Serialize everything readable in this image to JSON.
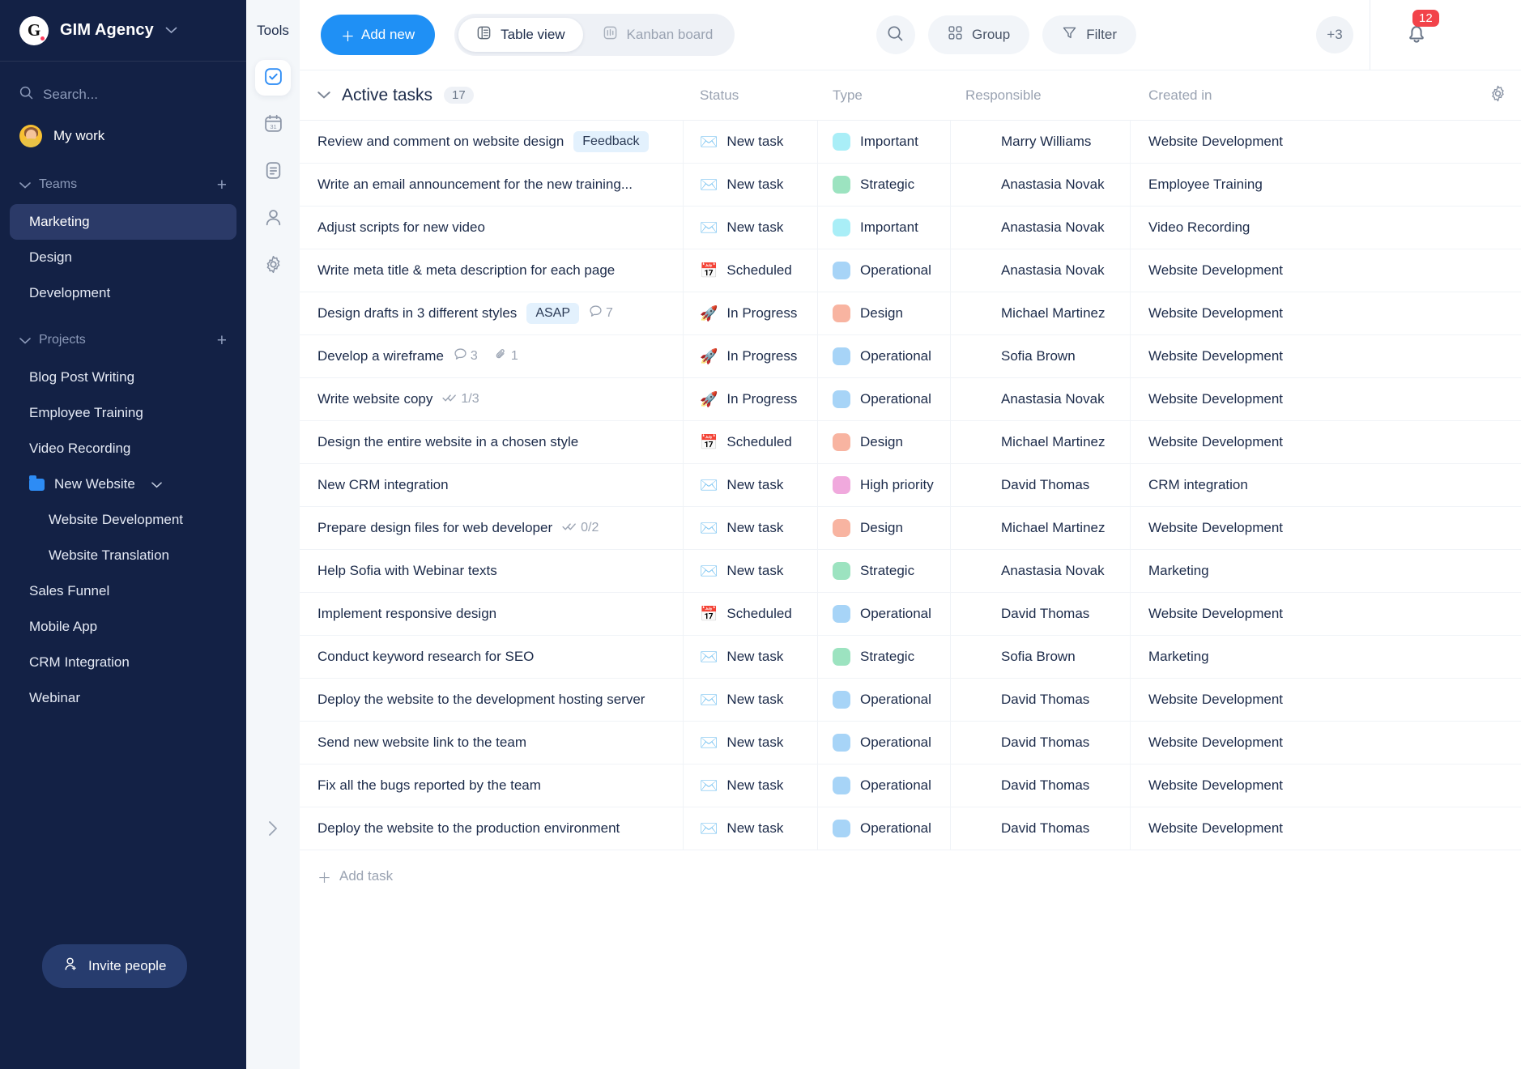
{
  "sidebar": {
    "brand": {
      "logo_letter": "G",
      "name": "GIM Agency",
      "caret": "chevron-down"
    },
    "search_placeholder": "Search...",
    "my_work": "My work",
    "teams_group": {
      "label": "Teams",
      "add": "+"
    },
    "teams": [
      "Marketing",
      "Design",
      "Development"
    ],
    "active_team": "Marketing",
    "projects_group": {
      "label": "Projects",
      "add": "+"
    },
    "projects": [
      "Blog Post Writing",
      "Employee Training",
      "Video Recording"
    ],
    "folder": {
      "label": "New Website",
      "children": [
        "Website Development",
        "Website Translation"
      ]
    },
    "projects_after": [
      "Sales Funnel",
      "Mobile App",
      "CRM Integration",
      "Webinar"
    ],
    "invite_label": "Invite people"
  },
  "tools": {
    "title": "Tools",
    "items": [
      {
        "name": "tasks-icon",
        "active": true
      },
      {
        "name": "calendar-icon",
        "active": false
      },
      {
        "name": "notes-icon",
        "active": false
      },
      {
        "name": "contacts-icon",
        "active": false
      },
      {
        "name": "settings-icon",
        "active": false
      }
    ],
    "expand": "›"
  },
  "topbar": {
    "add_new": "Add new",
    "views": [
      {
        "label": "Table view",
        "active": true,
        "icon": "table-icon"
      },
      {
        "label": "Kanban board",
        "active": false,
        "icon": "kanban-icon"
      }
    ],
    "search_icon": "search-icon",
    "group_label": "Group",
    "filter_label": "Filter",
    "members_overflow": "+3",
    "notifications_count": "12"
  },
  "table": {
    "group_title": "Active tasks",
    "group_count": "17",
    "columns": [
      "Status",
      "Type",
      "Responsible",
      "Created in"
    ],
    "add_task_label": "Add task",
    "type_colors": {
      "Important": "#a9eef7",
      "Strategic": "#9ce3c0",
      "Operational": "#a7d4f7",
      "Design": "#f8b4a1",
      "High priority": "#f0a9dd"
    },
    "status_icons": {
      "New task": "✉️",
      "Scheduled": "📅",
      "In Progress": "🚀"
    },
    "rows": [
      {
        "task": "Review and comment on website design",
        "tag": "Feedback",
        "meta": [],
        "status": "New task",
        "type": "Important",
        "responsible": "Marry Williams",
        "created": "Website Development",
        "av_bg": "#f7c033",
        "av_hair": "#8f5a34",
        "av_body": "#e9c246"
      },
      {
        "task": "Write an email announcement for the new training...",
        "tag": "",
        "meta": [],
        "status": "New task",
        "type": "Strategic",
        "responsible": "Anastasia Novak",
        "created": "Employee Training",
        "av_bg": "#ef4056",
        "av_hair": "#3b2418",
        "av_body": "#dfe6ee"
      },
      {
        "task": "Adjust scripts for new video",
        "tag": "",
        "meta": [],
        "status": "New task",
        "type": "Important",
        "responsible": "Anastasia Novak",
        "created": "Video Recording",
        "av_bg": "#ef4056",
        "av_hair": "#3b2418",
        "av_body": "#dfe6ee"
      },
      {
        "task": "Write meta title & meta description for each page",
        "tag": "",
        "meta": [],
        "status": "Scheduled",
        "type": "Operational",
        "responsible": "Anastasia Novak",
        "created": "Website Development",
        "av_bg": "#ef4056",
        "av_hair": "#3b2418",
        "av_body": "#dfe6ee"
      },
      {
        "task": "Design drafts in 3 different styles",
        "tag": "ASAP",
        "meta": [
          {
            "icon": "comment-icon",
            "value": "7"
          }
        ],
        "status": "In Progress",
        "type": "Design",
        "responsible": "Michael Martinez",
        "created": "Website Development",
        "av_bg": "#4fc3e8",
        "av_hair": "#2a1d16",
        "av_body": "#e7eef5"
      },
      {
        "task": "Develop a wireframe",
        "tag": "",
        "meta": [
          {
            "icon": "comment-icon",
            "value": "3"
          },
          {
            "icon": "attachment-icon",
            "value": "1"
          }
        ],
        "status": "In Progress",
        "type": "Operational",
        "responsible": "Sofia Brown",
        "created": "Website Development",
        "av_bg": "#ef4d7a",
        "av_hair": "#4a2a1c",
        "av_body": "#f2e4d8"
      },
      {
        "task": "Write website copy",
        "tag": "",
        "meta": [
          {
            "icon": "checklist-icon",
            "value": "1/3"
          }
        ],
        "status": "In Progress",
        "type": "Operational",
        "responsible": "Anastasia Novak",
        "created": "Website Development",
        "av_bg": "#ef4056",
        "av_hair": "#3b2418",
        "av_body": "#dfe6ee"
      },
      {
        "task": "Design the entire website in a chosen style",
        "tag": "",
        "meta": [],
        "status": "Scheduled",
        "type": "Design",
        "responsible": "Michael Martinez",
        "created": "Website Development",
        "av_bg": "#4fc3e8",
        "av_hair": "#2a1d16",
        "av_body": "#e7eef5"
      },
      {
        "task": "New CRM integration",
        "tag": "",
        "meta": [],
        "status": "New task",
        "type": "High priority",
        "responsible": "David Thomas",
        "created": "CRM integration",
        "av_bg": "#6b4ff0",
        "av_hair": "#2c1c14",
        "av_body": "#cfd9e8"
      },
      {
        "task": "Prepare design files for web developer",
        "tag": "",
        "meta": [
          {
            "icon": "checklist-icon",
            "value": "0/2"
          }
        ],
        "status": "New task",
        "type": "Design",
        "responsible": "Michael Martinez",
        "created": "Website Development",
        "av_bg": "#4fc3e8",
        "av_hair": "#2a1d16",
        "av_body": "#e7eef5"
      },
      {
        "task": "Help Sofia with Webinar texts",
        "tag": "",
        "meta": [],
        "status": "New task",
        "type": "Strategic",
        "responsible": "Anastasia Novak",
        "created": "Marketing",
        "av_bg": "#ef4056",
        "av_hair": "#3b2418",
        "av_body": "#dfe6ee"
      },
      {
        "task": "Implement responsive design",
        "tag": "",
        "meta": [],
        "status": "Scheduled",
        "type": "Operational",
        "responsible": "David Thomas",
        "created": "Website Development",
        "av_bg": "#6b4ff0",
        "av_hair": "#2c1c14",
        "av_body": "#cfd9e8"
      },
      {
        "task": "Conduct keyword research for SEO",
        "tag": "",
        "meta": [],
        "status": "New task",
        "type": "Strategic",
        "responsible": "Sofia Brown",
        "created": "Marketing",
        "av_bg": "#ef4d7a",
        "av_hair": "#4a2a1c",
        "av_body": "#f2e4d8"
      },
      {
        "task": "Deploy the website to the development hosting server",
        "tag": "",
        "meta": [],
        "status": "New task",
        "type": "Operational",
        "responsible": "David Thomas",
        "created": "Website Development",
        "av_bg": "#6b4ff0",
        "av_hair": "#2c1c14",
        "av_body": "#cfd9e8"
      },
      {
        "task": "Send new website link to the team",
        "tag": "",
        "meta": [],
        "status": "New task",
        "type": "Operational",
        "responsible": "David Thomas",
        "created": "Website Development",
        "av_bg": "#6b4ff0",
        "av_hair": "#2c1c14",
        "av_body": "#cfd9e8"
      },
      {
        "task": "Fix all the bugs reported by the team",
        "tag": "",
        "meta": [],
        "status": "New task",
        "type": "Operational",
        "responsible": "David Thomas",
        "created": "Website Development",
        "av_bg": "#6b4ff0",
        "av_hair": "#2c1c14",
        "av_body": "#cfd9e8"
      },
      {
        "task": "Deploy the website to the production environment",
        "tag": "",
        "meta": [],
        "status": "New task",
        "type": "Operational",
        "responsible": "David Thomas",
        "created": "Website Development",
        "av_bg": "#6b4ff0",
        "av_hair": "#2c1c14",
        "av_body": "#cfd9e8"
      }
    ]
  },
  "members": [
    {
      "bg": "#f7c033",
      "hair": "#8f5a34",
      "body": "#e9c246"
    },
    {
      "bg": "#ef4056",
      "hair": "#3b2418",
      "body": "#dfe6ee"
    },
    {
      "bg": "#7b5cf0",
      "hair": "#3a2418",
      "body": "#e05a4a"
    },
    {
      "bg": "#f0479b",
      "hair": "#231610",
      "body": "#2c3e55"
    },
    {
      "bg": "#4fc3e8",
      "hair": "#2a1d16",
      "body": "#c9d6e3"
    }
  ]
}
